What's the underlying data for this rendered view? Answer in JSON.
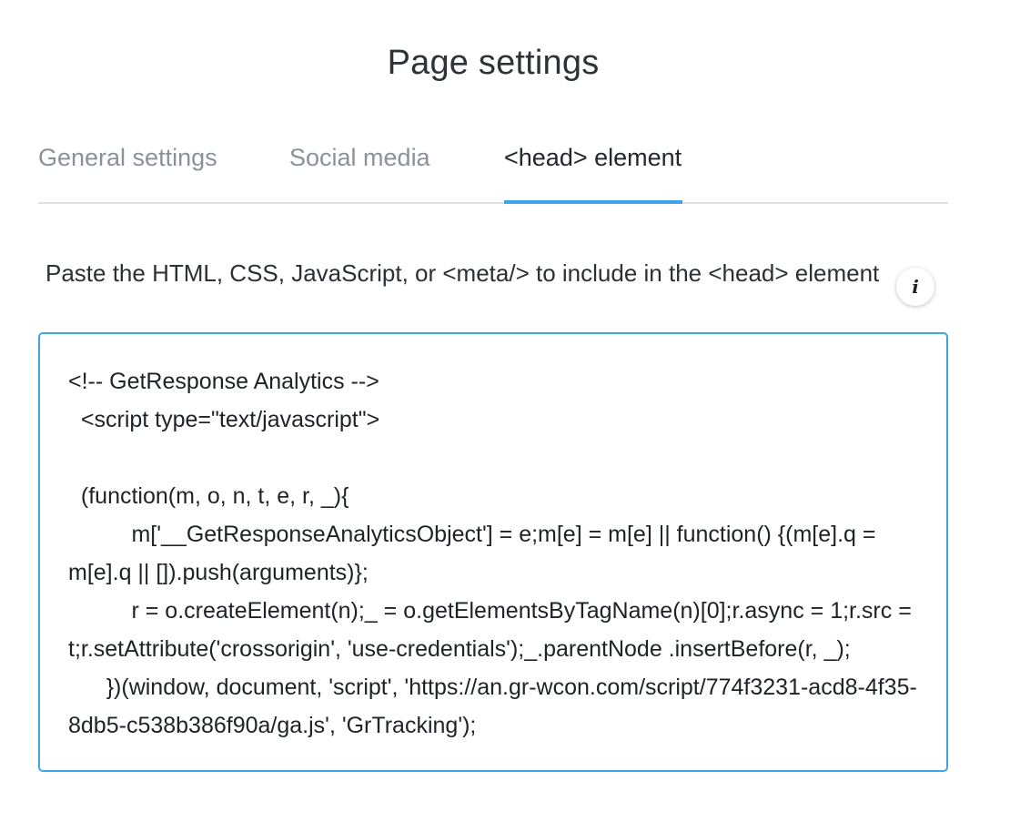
{
  "page": {
    "title": "Page settings"
  },
  "tabs": [
    {
      "label": "General settings",
      "active": false
    },
    {
      "label": "Social media",
      "active": false
    },
    {
      "label": "<head> element",
      "active": true
    }
  ],
  "head_section": {
    "description": "Paste the HTML, CSS, JavaScript, or <meta/> to include in the <head> element",
    "info_icon": "info-icon",
    "code_lines": [
      "<!-- GetResponse Analytics -->",
      "  <script type=\"text/javascript\">",
      "",
      "  (function(m, o, n, t, e, r, _){",
      "          m['__GetResponseAnalyticsObject'] = e;m[e] = m[e] || function() {(m[e].q = m[e].q || []).push(arguments)};",
      "          r = o.createElement(n);_ = o.getElementsByTagName(n)[0];r.async = 1;r.src = t;r.setAttribute('crossorigin', 'use-credentials');_.parentNode .insertBefore(r, _);",
      "      })(window, document, 'script', 'https://an.gr-wcon.com/script/774f3231-acd8-4f35-8db5-c538b386f90a/ga.js', 'GrTracking');"
    ]
  },
  "colors": {
    "accent": "#3fa3e8",
    "tab_inactive": "#8c9198",
    "text": "#2c2f33"
  }
}
